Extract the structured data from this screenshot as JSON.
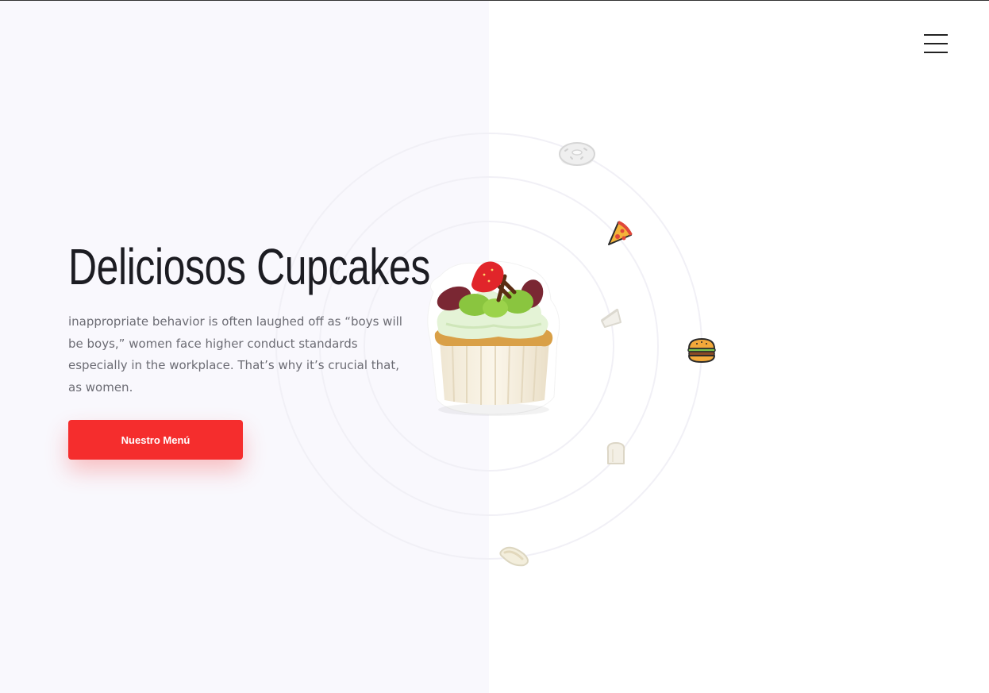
{
  "header": {
    "menu_icon": "hamburger-menu-icon"
  },
  "hero": {
    "title": "Deliciosos Cupcakes",
    "description": "inappropriate behavior is often laughed off as “boys will be boys,” women face higher conduct standards especially in the workplace. That’s why it’s crucial that, as women.",
    "cta_label": "Nuestro Menú",
    "image": "cupcake-image"
  },
  "orbit_icons": [
    "donut-icon",
    "pizza-slice-icon",
    "cake-slice-icon",
    "burger-icon",
    "bread-toast-icon",
    "hotdog-icon"
  ],
  "colors": {
    "accent": "#f52d2d",
    "left_panel_bg": "#f9f8fd",
    "page_bg": "#ffffff",
    "title_text": "#1c1c22",
    "body_text": "#6c6c74"
  }
}
